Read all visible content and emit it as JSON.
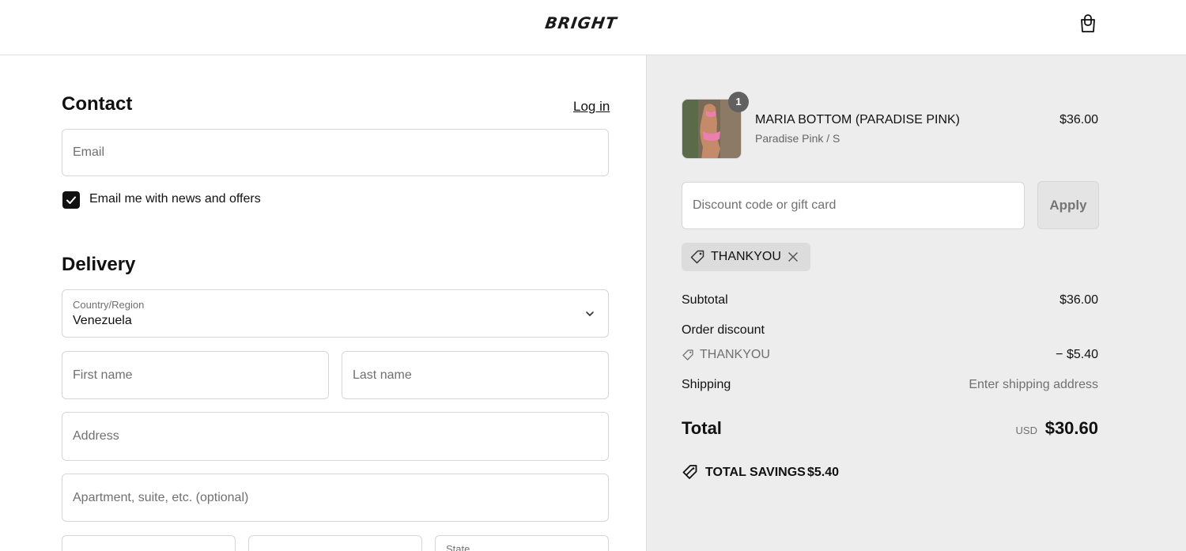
{
  "header": {
    "logo": "BRIGHT",
    "cart_icon": "shopping-bag-icon"
  },
  "contact": {
    "title": "Contact",
    "login_link": "Log in",
    "email_placeholder": "Email",
    "newsletter_label": "Email me with news and offers",
    "newsletter_checked": true
  },
  "delivery": {
    "title": "Delivery",
    "country_label": "Country/Region",
    "country_value": "Venezuela",
    "first_name_placeholder": "First name",
    "last_name_placeholder": "Last name",
    "address_placeholder": "Address",
    "apartment_placeholder": "Apartment, suite, etc. (optional)",
    "state_label": "State"
  },
  "order": {
    "item": {
      "name": "MARIA BOTTOM (PARADISE PINK)",
      "variant": "Paradise Pink / S",
      "price": "$36.00",
      "quantity": "1"
    },
    "discount_placeholder": "Discount code or gift card",
    "apply_label": "Apply",
    "applied_code": "THANKYOU",
    "subtotal_label": "Subtotal",
    "subtotal_value": "$36.00",
    "order_discount_label": "Order discount",
    "discount_code": "THANKYOU",
    "discount_value": "− $5.40",
    "shipping_label": "Shipping",
    "shipping_value": "Enter shipping address",
    "total_label": "Total",
    "total_currency": "USD",
    "total_value": "$30.60",
    "savings_label": "TOTAL SAVINGS",
    "savings_value": "$5.40"
  },
  "colors": {
    "sidebar_bg": "#ededed",
    "accent": "#111111",
    "muted_text": "#707070"
  }
}
